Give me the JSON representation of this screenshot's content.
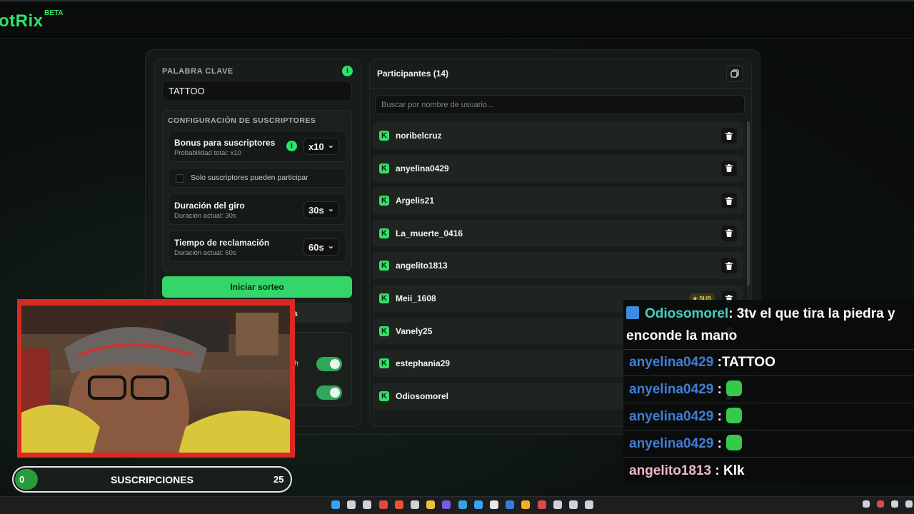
{
  "app": {
    "logo": "otRix",
    "beta": "BETA"
  },
  "keyword": {
    "label": "PALABRA CLAVE",
    "value": "TATTOO",
    "info": "i"
  },
  "subscribers": {
    "title": "CONFIGURACIÓN DE SUSCRIPTORES",
    "bonus": {
      "title": "Bonus para suscriptores",
      "subtitle": "Probabilidad total: x10",
      "value": "x10",
      "info": "i"
    },
    "only_subs_label": "Solo suscriptores pueden participar",
    "spin": {
      "title": "Duración del giro",
      "subtitle": "Duración actual: 30s",
      "value": "30s"
    },
    "claim": {
      "title": "Tiempo de reclamación",
      "subtitle": "Duración actual: 60s",
      "value": "60s"
    }
  },
  "actions": {
    "start": "Iniciar sorteo",
    "secondary_partial": "s",
    "toggle1_partial": "h"
  },
  "participants": {
    "title": "Participantes (14)",
    "search_placeholder": "Buscar por nombre de usuario...",
    "items": [
      {
        "name": "noribelcruz",
        "sub": false
      },
      {
        "name": "anyelina0429",
        "sub": false
      },
      {
        "name": "Argelis21",
        "sub": false
      },
      {
        "name": "La_muerte_0416",
        "sub": false
      },
      {
        "name": "angelito1813",
        "sub": false
      },
      {
        "name": "Meii_1608",
        "sub": true,
        "badge": "SUB"
      },
      {
        "name": "Vanely25",
        "sub": false
      },
      {
        "name": "estephania29",
        "sub": false
      },
      {
        "name": "Odiosomorel",
        "sub": false
      }
    ]
  },
  "stream_overlay": {
    "stats": {
      "left": "0",
      "label": "SUSCRIPCIONES",
      "right": "25"
    },
    "chat": [
      {
        "user": "Odiosomorel",
        "text": ": 3tv el que tira la piedra y",
        "color": "#45d0c0"
      },
      {
        "user": "",
        "text": "enconde la mano",
        "color": "#ffffff"
      },
      {
        "user": "anyelina0429",
        "text": " :TATTOO",
        "color": "#3f7ed8"
      },
      {
        "user": "anyelina0429",
        "text": " :",
        "color": "#3f7ed8",
        "emote": true
      },
      {
        "user": "anyelina0429",
        "text": " :",
        "color": "#3f7ed8",
        "emote": true
      },
      {
        "user": "anyelina0429",
        "text": " :",
        "color": "#3f7ed8",
        "emote": true
      },
      {
        "user": "angelito1813",
        "text": " : Klk",
        "color": "#f0b8c8"
      }
    ]
  },
  "colors": {
    "accent": "#2ee36b",
    "button": "#34d66a",
    "webcam_frame": "#d82a22"
  }
}
